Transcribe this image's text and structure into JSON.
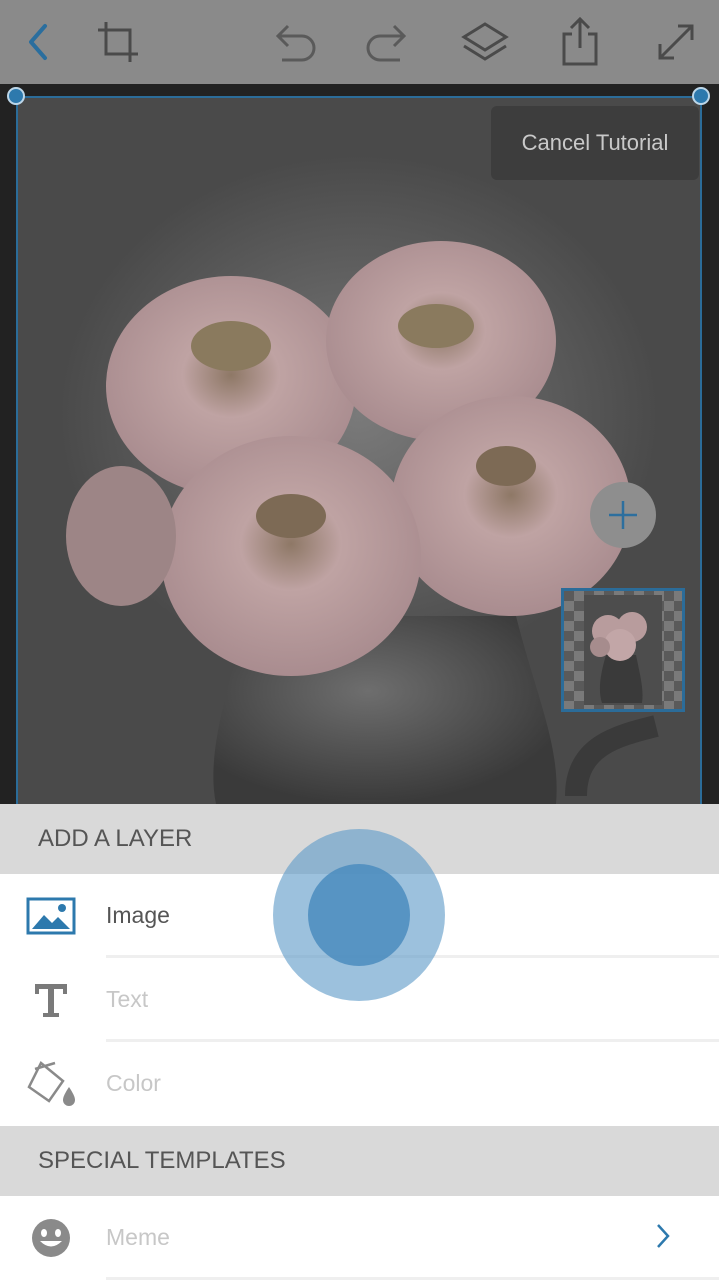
{
  "canvas": {
    "cancel_tutorial_label": "Cancel Tutorial"
  },
  "add_layer": {
    "header": "ADD A LAYER",
    "items": [
      {
        "label": "Image",
        "icon": "image-icon"
      },
      {
        "label": "Text",
        "icon": "text-icon"
      },
      {
        "label": "Color",
        "icon": "paint-bucket-icon"
      }
    ]
  },
  "special_templates": {
    "header": "SPECIAL TEMPLATES",
    "items": [
      {
        "label": "Meme",
        "icon": "smiley-icon"
      }
    ]
  },
  "colors": {
    "accent": "#2d79ad",
    "toolbar": "#8a8a8a",
    "header_bg": "#d9d9d9"
  }
}
